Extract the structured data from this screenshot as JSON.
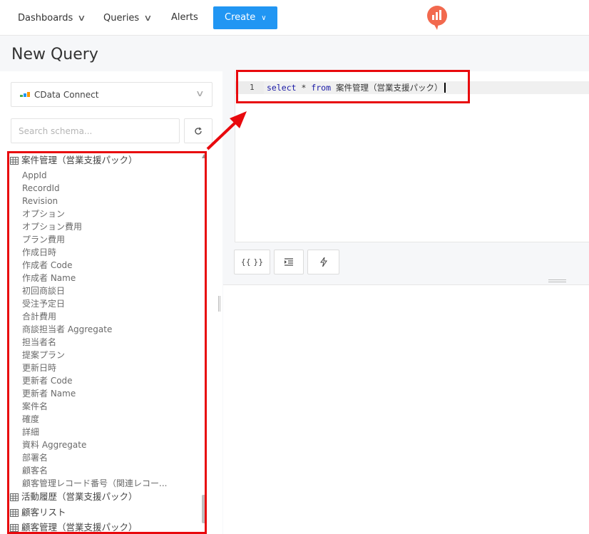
{
  "navbar": {
    "items": [
      "Dashboards",
      "Queries",
      "Alerts"
    ],
    "create_label": "Create"
  },
  "page": {
    "title": "New Query"
  },
  "datasource": {
    "label": "CData Connect"
  },
  "search": {
    "placeholder": "Search schema..."
  },
  "schema": {
    "tables": [
      {
        "name": "案件管理（営業支援パック）",
        "columns": [
          "AppId",
          "RecordId",
          "Revision",
          "オプション",
          "オプション費用",
          "プラン費用",
          "作成日時",
          "作成者 Code",
          "作成者 Name",
          "初回商談日",
          "受注予定日",
          "合計費用",
          "商談担当者 Aggregate",
          "担当者名",
          "提案プラン",
          "更新日時",
          "更新者 Code",
          "更新者 Name",
          "案件名",
          "確度",
          "詳細",
          "資料 Aggregate",
          "部署名",
          "顧客名",
          "顧客管理レコード番号（関連レコー..."
        ]
      },
      {
        "name": "活動履歴（営業支援パック）",
        "columns": []
      },
      {
        "name": "顧客リスト",
        "columns": []
      },
      {
        "name": "顧客管理（営業支援パック）",
        "columns": []
      }
    ]
  },
  "editor": {
    "line_number": "1",
    "tokens": {
      "kw1": "select",
      "op": " * ",
      "kw2": "from",
      "rest": " 案件管理（営業支援パック）"
    }
  },
  "toolbar": {
    "params_label": "{{ }}"
  },
  "colors": {
    "accent": "#2196f3",
    "highlight_box": "#e8090d",
    "keyword": "#1a1aa6",
    "logo": "#f2694e"
  }
}
